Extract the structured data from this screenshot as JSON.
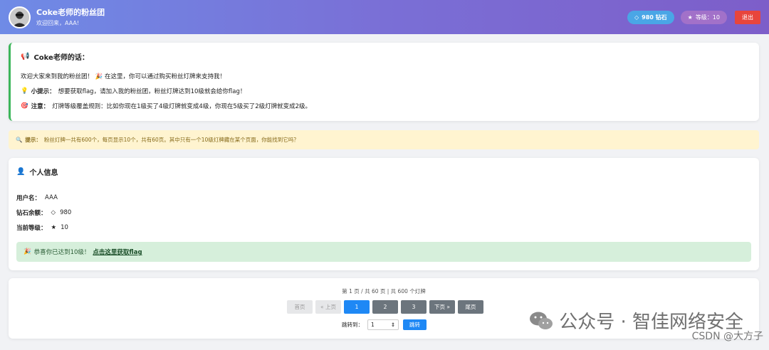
{
  "header": {
    "title": "Coke老师的粉丝团",
    "subtitle": "欢迎回来，AAA!",
    "diamond_label": "980 钻石",
    "level_label": "等级：10",
    "logout_label": "退出"
  },
  "message": {
    "title": "Coke老师的话：",
    "line1": "欢迎大家来到我的粉丝团！ 🎉 在这里，你可以通过购买粉丝灯牌来支持我！",
    "tip_label": "小提示：",
    "tip_text": "想要获取flag，请加入我的粉丝团，粉丝灯牌达到10级就会给你flag！",
    "note_label": "注意：",
    "note_text": "灯牌等级覆盖规则：比如你现在1级买了4级灯牌就变成4级，你现在5级买了2级灯牌就变成2级。"
  },
  "notice": {
    "label": "提示：",
    "text": "粉丝灯牌一共有600个，每页显示10个，共有60页。其中只有一个10级灯牌藏在某个页面，你能找到它吗？"
  },
  "profile": {
    "title": "个人信息",
    "username_label": "用户名：",
    "username": "AAA",
    "diamond_label": "钻石余额：",
    "diamond": "980",
    "level_label": "当前等级：",
    "level": "10",
    "success_text": "恭喜你已达到10级！",
    "flag_link": "点击这里获取flag"
  },
  "pagination": {
    "info": "第 1 页 / 共 60 页 | 共 600 个灯牌",
    "first": "首页",
    "prev": "« 上页",
    "pages": [
      "1",
      "2",
      "3"
    ],
    "next": "下页 »",
    "last": "尾页",
    "jump_label": "跳转到：",
    "jump_value": "1",
    "jump_button": "跳转"
  },
  "watermark": {
    "text": "公众号 · 智佳网络安全",
    "csdn": "CSDN @大方子"
  },
  "colors": {
    "header_gradient_start": "#6f8be6",
    "header_gradient_end": "#7d5ec9",
    "accent_blue": "#1e88f5",
    "success_green": "#3cb65a",
    "logout_red": "#e8453c"
  }
}
